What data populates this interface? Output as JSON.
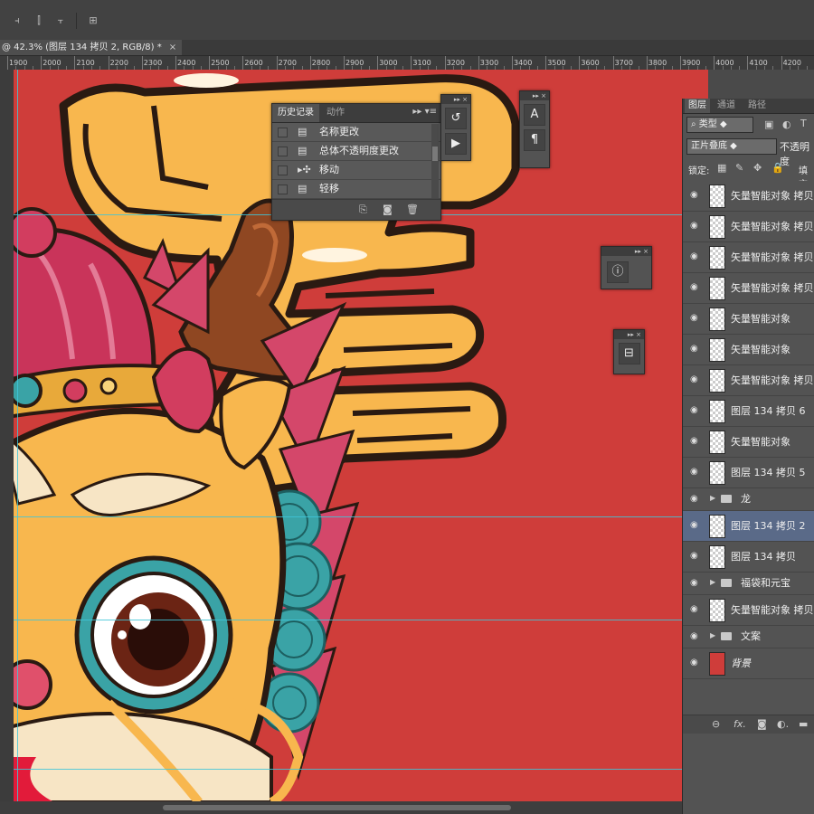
{
  "document_tab": {
    "title": "@ 42.3% (图层 134 拷贝 2, RGB/8) *",
    "close": "×"
  },
  "ruler": {
    "ticks": [
      "1900",
      "2000",
      "2100",
      "2200",
      "2300",
      "2400",
      "2500",
      "2600",
      "2700",
      "2800",
      "2900",
      "3000",
      "3100",
      "3200",
      "3300",
      "3400",
      "3500",
      "3600",
      "3700",
      "3800",
      "3900",
      "4000",
      "4100",
      "4200"
    ]
  },
  "history_panel": {
    "tabs": [
      "历史记录",
      "动作"
    ],
    "items": [
      {
        "icon": "document-icon",
        "label": "名称更改"
      },
      {
        "icon": "document-icon",
        "label": "总体不透明度更改"
      },
      {
        "icon": "move-icon",
        "label": "移动"
      },
      {
        "icon": "document-icon",
        "label": "轻移"
      }
    ]
  },
  "layers_panel": {
    "tabs": [
      "图层",
      "通道",
      "路径"
    ],
    "filter_kind": "类型",
    "blend_mode": "正片叠底",
    "opacity_label": "不透明度",
    "lock_label": "锁定:",
    "fill_label": "填充",
    "layers": [
      {
        "name": "矢量智能对象 拷贝",
        "type": "layer"
      },
      {
        "name": "矢量智能对象 拷贝",
        "type": "layer"
      },
      {
        "name": "矢量智能对象 拷贝",
        "type": "layer"
      },
      {
        "name": "矢量智能对象 拷贝",
        "type": "layer"
      },
      {
        "name": "矢量智能对象",
        "type": "layer"
      },
      {
        "name": "矢量智能对象",
        "type": "layer"
      },
      {
        "name": "矢量智能对象 拷贝",
        "type": "layer"
      },
      {
        "name": "图层 134 拷贝 6",
        "type": "layer"
      },
      {
        "name": "矢量智能对象",
        "type": "layer"
      },
      {
        "name": "图层 134 拷贝 5",
        "type": "layer"
      },
      {
        "name": "龙",
        "type": "group"
      },
      {
        "name": "图层 134 拷贝 2",
        "type": "layer",
        "selected": true
      },
      {
        "name": "图层 134 拷贝",
        "type": "layer"
      },
      {
        "name": "福袋和元宝",
        "type": "group"
      },
      {
        "name": "矢量智能对象 拷贝",
        "type": "layer"
      },
      {
        "name": "文案",
        "type": "group"
      },
      {
        "name": "背景",
        "type": "background"
      }
    ],
    "footer_icons": [
      "link-icon",
      "fx-icon",
      "mask-icon",
      "adjustment-icon",
      "folder-icon"
    ]
  },
  "colors": {
    "canvas_red": "#cf3d3a",
    "yellow": "#f8b74e",
    "outline": "#2a1a12",
    "guide": "#3fc6d8",
    "selection": "#5a6a88"
  }
}
